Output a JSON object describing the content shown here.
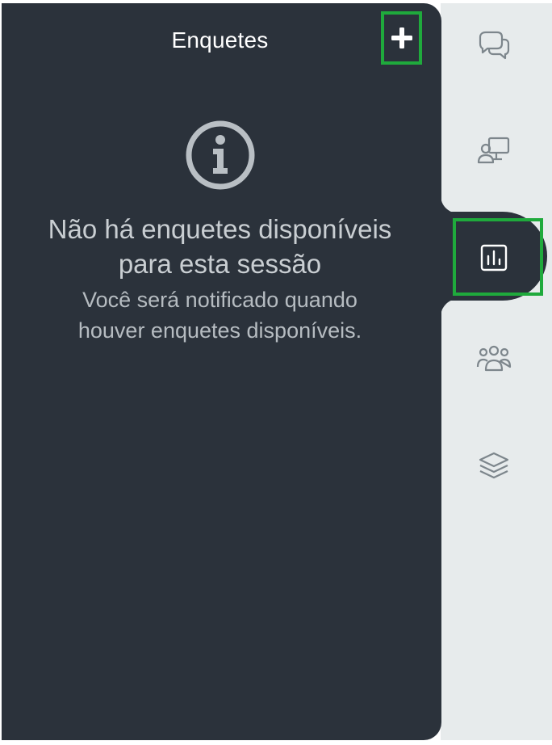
{
  "panel": {
    "title": "Enquetes",
    "add_button_label": "+",
    "empty_title_line1": "Não há enquetes disponíveis",
    "empty_title_line2": "para esta sessão",
    "empty_sub_line1": "Você será notificado quando",
    "empty_sub_line2": "houver enquetes disponíveis."
  },
  "rail": {
    "items": [
      {
        "icon": "chat-icon",
        "active": false
      },
      {
        "icon": "presenter-icon",
        "active": false
      },
      {
        "icon": "poll-icon",
        "active": true
      },
      {
        "icon": "participants-icon",
        "active": false
      },
      {
        "icon": "layers-icon",
        "active": false
      }
    ]
  },
  "colors": {
    "panel_bg": "#2b323b",
    "rail_bg": "#e7ebec",
    "highlight": "#1faa3c",
    "title": "#ffffff",
    "muted_text": "#c9ced2"
  }
}
